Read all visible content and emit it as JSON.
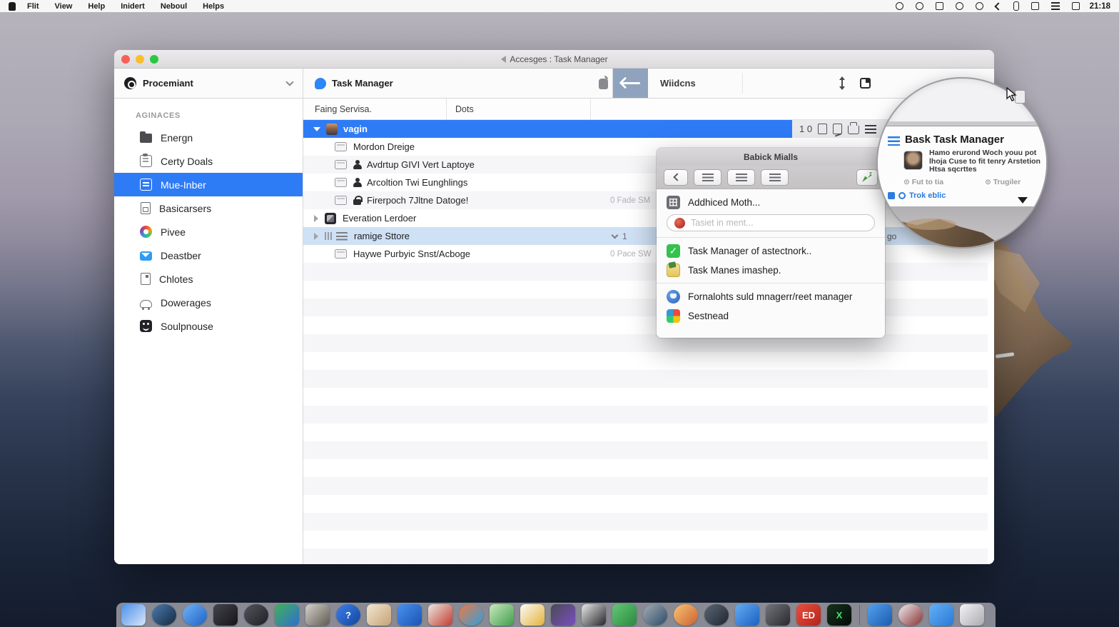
{
  "menubar": {
    "menus": [
      "Flit",
      "View",
      "Help",
      "Inidert",
      "Neboul",
      "Helps"
    ],
    "status_icons": [
      "link-icon",
      "pie-icon",
      "notes-icon",
      "search-icon",
      "shield-icon",
      "chevron-left-icon",
      "phone-icon",
      "flag-icon",
      "trackpad-icon",
      "display-icon"
    ],
    "clock": "21:18"
  },
  "window": {
    "title": "Accesges : Task Manager",
    "toolbar": {
      "app_title": "Task Manager",
      "windows_label": "Wiidcns"
    },
    "sidebar": {
      "profile": "Procemiant",
      "section": "AGINACES",
      "items": [
        {
          "label": "Energn",
          "icon": "folder"
        },
        {
          "label": "Certy Doals",
          "icon": "clip"
        },
        {
          "label": "Mue-Inber",
          "icon": "list",
          "selected": true
        },
        {
          "label": "Basicarsers",
          "icon": "page"
        },
        {
          "label": "Pivee",
          "icon": "pin"
        },
        {
          "label": "Deastber",
          "icon": "mail"
        },
        {
          "label": "Chlotes",
          "icon": "page2"
        },
        {
          "label": "Dowerages",
          "icon": "car"
        },
        {
          "label": "Soulpnouse",
          "icon": "smile"
        }
      ]
    },
    "columns": {
      "col1": "Faing Servisa.",
      "col2": "Dots"
    },
    "primary_row": {
      "label": "vagin",
      "count": "1 0"
    },
    "rows": [
      {
        "label": "Mordon Dreige",
        "indent": 1,
        "icon": "card"
      },
      {
        "label": "Avdrtup GIVI Vert Laptoye",
        "indent": 1,
        "icon": "card",
        "badge": "person"
      },
      {
        "label": "Arcoltion Twi Eunghlings",
        "indent": 1,
        "icon": "card",
        "badge": "person"
      },
      {
        "label": "Firerpoch 7Jltne Datoge!",
        "indent": 1,
        "icon": "card",
        "badge": "lock",
        "right": "0 Fade SM"
      },
      {
        "label": "Everation Lerdoer",
        "indent": 0,
        "disclosure": true,
        "icon": "darkapp"
      },
      {
        "label": "ramige Sttore",
        "indent": 0,
        "disclosure": true,
        "icon": "lines",
        "mini": true,
        "selected": true,
        "rchev": "1",
        "right2": "go"
      },
      {
        "label": "Haywe Purbyic Snst/Acboge",
        "indent": 1,
        "icon": "card",
        "right": "0 Pace SW"
      }
    ]
  },
  "popup": {
    "title": "Babick Mialls",
    "search_placeholder": "Tasiet in ment...",
    "row1": "Addhiced Moth...",
    "items": [
      {
        "label": "Task Manager of astectnork..",
        "icon": "check"
      },
      {
        "label": "Task Manes imashep.",
        "icon": "yellow"
      },
      {
        "label": "Fornalohts suld mnagerr/reet manager",
        "icon": "blue"
      },
      {
        "label": "Sestnead",
        "icon": "color"
      }
    ]
  },
  "magnifier": {
    "title": "Bask Task Manager",
    "body": "Hamo erurond Woch youu pot lhoja Cuse to fit tenry Arstetion Htsa sqcrttes",
    "meta1": "Fut to tia",
    "meta2": "Trugiler",
    "link": "Trok eblic"
  },
  "dock": {
    "items": [
      {
        "name": "pages",
        "s": "r",
        "c1": "#4a90ee",
        "c2": "#d9e6f6"
      },
      {
        "name": "dark-globe",
        "s": "c",
        "c1": "#4a7bb0",
        "c2": "#16293e"
      },
      {
        "name": "compass",
        "s": "c",
        "c1": "#6fb2f5",
        "c2": "#1e62c8"
      },
      {
        "name": "dark-editor",
        "s": "r",
        "c1": "#44444c",
        "c2": "#151519"
      },
      {
        "name": "pen-circle",
        "s": "c",
        "c1": "#55555e",
        "c2": "#1e1e24"
      },
      {
        "name": "mini-color",
        "s": "r",
        "c1": "#41b058",
        "c2": "#2f6fd0"
      },
      {
        "name": "glass",
        "s": "r",
        "c1": "#d6d2cb",
        "c2": "#5e5a52"
      },
      {
        "name": "help",
        "s": "c",
        "c1": "#3f7fe8",
        "c2": "#12459e",
        "t": "?",
        "tc": "#fff"
      },
      {
        "name": "cards",
        "s": "r",
        "c1": "#f2e7d2",
        "c2": "#c5a276"
      },
      {
        "name": "bird",
        "s": "r",
        "c1": "#4a90ee",
        "c2": "#1a55b4"
      },
      {
        "name": "paddle",
        "s": "r",
        "c1": "#ece8e2",
        "c2": "#c23b2e"
      },
      {
        "name": "swirl",
        "s": "c",
        "c1": "#ef7a42",
        "c2": "#2f9ede"
      },
      {
        "name": "tree",
        "s": "r",
        "c1": "#cbe8bc",
        "c2": "#3f9e4e"
      },
      {
        "name": "calendar",
        "s": "r",
        "c1": "#fbfbf8",
        "c2": "#e4b23a"
      },
      {
        "name": "photos-dark",
        "s": "r",
        "c1": "#4a4a54",
        "c2": "#7a4fc0"
      },
      {
        "name": "bw-app",
        "s": "r",
        "c1": "#e8e8e8",
        "c2": "#26262a"
      },
      {
        "name": "recycle",
        "s": "r",
        "c1": "#63c674",
        "c2": "#2a8a40"
      },
      {
        "name": "gear-globe",
        "s": "c",
        "c1": "#a4adb6",
        "c2": "#2c4a66"
      },
      {
        "name": "orange-face",
        "s": "c",
        "c1": "#f6c670",
        "c2": "#cc5f34"
      },
      {
        "name": "person-dark",
        "s": "c",
        "c1": "#5c6674",
        "c2": "#1e2630"
      },
      {
        "name": "sail",
        "s": "r",
        "c1": "#64acf2",
        "c2": "#1a60c2"
      },
      {
        "name": "clock-dark",
        "s": "r",
        "c1": "#74747c",
        "c2": "#28282e"
      },
      {
        "name": "red-ed",
        "s": "r",
        "c1": "#ea4e3c",
        "c2": "#b2241a",
        "t": "ED",
        "tc": "#fff"
      },
      {
        "name": "terminal",
        "s": "r",
        "c1": "#17331f",
        "c2": "#030a05",
        "t": "X",
        "tc": "#3fe86a"
      },
      {
        "name": "sep"
      },
      {
        "name": "blue-photo",
        "s": "r",
        "c1": "#54a0ec",
        "c2": "#1a5cb0"
      },
      {
        "name": "compass2",
        "s": "c",
        "c1": "#eeeef2",
        "c2": "#8a3030"
      },
      {
        "name": "folder",
        "s": "r",
        "c1": "#63b0f4",
        "c2": "#2a7ad8"
      },
      {
        "name": "trash",
        "s": "r",
        "c1": "#f4f4f6",
        "c2": "#aaaab0"
      }
    ]
  }
}
